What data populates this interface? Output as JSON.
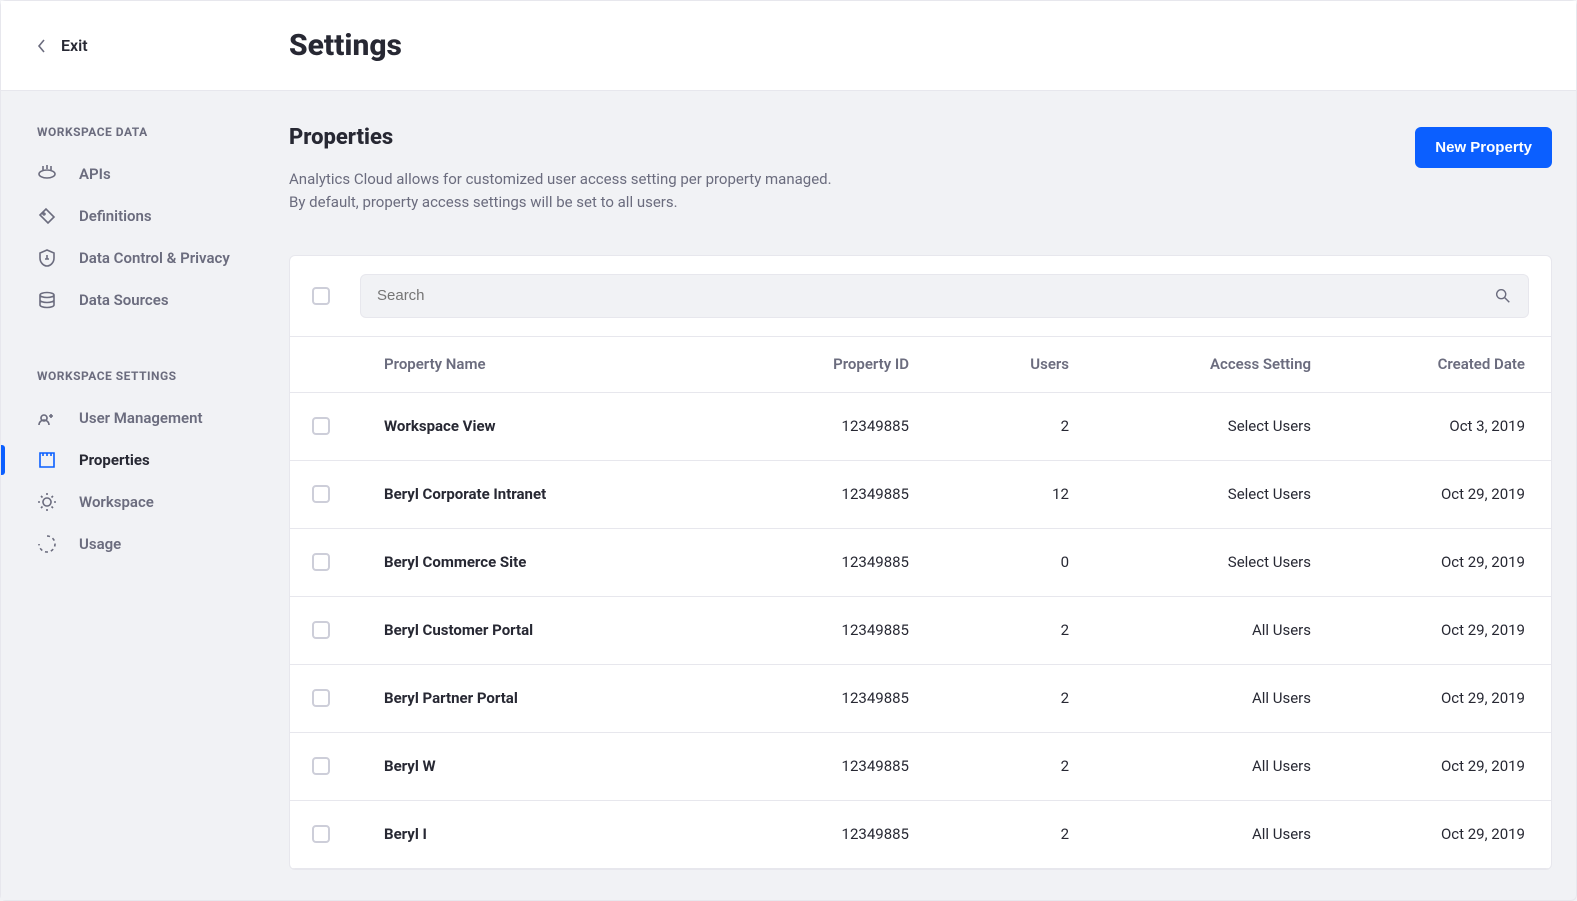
{
  "header": {
    "exit_label": "Exit",
    "title": "Settings"
  },
  "sidebar": {
    "groups": [
      {
        "title": "WORKSPACE DATA",
        "items": [
          {
            "label": "APIs"
          },
          {
            "label": "Definitions"
          },
          {
            "label": "Data Control & Privacy"
          },
          {
            "label": "Data Sources"
          }
        ]
      },
      {
        "title": "WORKSPACE SETTINGS",
        "items": [
          {
            "label": "User Management"
          },
          {
            "label": "Properties"
          },
          {
            "label": "Workspace"
          },
          {
            "label": "Usage"
          }
        ]
      }
    ]
  },
  "main": {
    "title": "Properties",
    "desc_line1": "Analytics Cloud allows for customized user access setting per property managed.",
    "desc_line2": "By default, property access settings will be set to all users.",
    "new_button": "New Property",
    "search_placeholder": "Search",
    "columns": {
      "name": "Property Name",
      "id": "Property ID",
      "users": "Users",
      "access": "Access Setting",
      "created": "Created Date"
    },
    "rows": [
      {
        "name": "Workspace View",
        "id": "12349885",
        "users": "2",
        "access": "Select Users",
        "created": "Oct 3, 2019"
      },
      {
        "name": "Beryl Corporate Intranet",
        "id": "12349885",
        "users": "12",
        "access": "Select Users",
        "created": "Oct 29, 2019"
      },
      {
        "name": "Beryl Commerce Site",
        "id": "12349885",
        "users": "0",
        "access": "Select Users",
        "created": "Oct 29, 2019"
      },
      {
        "name": "Beryl Customer Portal",
        "id": "12349885",
        "users": "2",
        "access": "All Users",
        "created": "Oct 29, 2019"
      },
      {
        "name": "Beryl Partner Portal",
        "id": "12349885",
        "users": "2",
        "access": "All Users",
        "created": "Oct 29, 2019"
      },
      {
        "name": "Beryl W",
        "id": "12349885",
        "users": "2",
        "access": "All Users",
        "created": "Oct 29, 2019"
      },
      {
        "name": "Beryl I",
        "id": "12349885",
        "users": "2",
        "access": "All Users",
        "created": "Oct 29, 2019"
      }
    ]
  }
}
